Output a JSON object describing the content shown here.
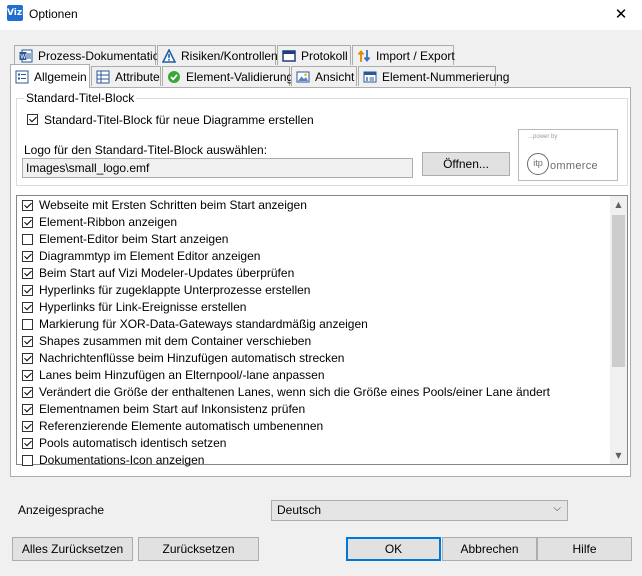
{
  "window": {
    "title": "Optionen",
    "app_icon_label": "Vizi",
    "close_glyph": "✕"
  },
  "tabs_row1": [
    {
      "label": "Prozess-Dokumentation",
      "icon": "word-doc-icon"
    },
    {
      "label": "Risiken/Kontrollen",
      "icon": "warning-triangle-icon"
    },
    {
      "label": "Protokoll",
      "icon": "window-log-icon"
    },
    {
      "label": "Import / Export",
      "icon": "import-export-arrows-icon"
    }
  ],
  "tabs_row2": [
    {
      "label": "Allgemein",
      "icon": "list-icon",
      "active": true
    },
    {
      "label": "Attribute",
      "icon": "table-icon"
    },
    {
      "label": "Element-Validierung",
      "icon": "green-check-icon"
    },
    {
      "label": "Ansicht",
      "icon": "image-view-icon"
    },
    {
      "label": "Element-Nummerierung",
      "icon": "numbering-icon"
    }
  ],
  "title_block": {
    "group_label": "Standard-Titel-Block",
    "checkbox_label": "Standard-Titel-Block für neue Diagramme erstellen",
    "checkbox_checked": true,
    "logo_label": "Logo für den Standard-Titel-Block auswählen:",
    "logo_path": "Images\\small_logo.emf",
    "open_button": "Öffnen...",
    "logo_preview": {
      "small_text": "…power by",
      "circle_text": "itp",
      "word_text": "ommerce"
    }
  },
  "options_list": [
    {
      "label": "Webseite mit Ersten Schritten beim Start anzeigen",
      "checked": true
    },
    {
      "label": "Element-Ribbon anzeigen",
      "checked": true
    },
    {
      "label": "Element-Editor beim Start anzeigen",
      "checked": false
    },
    {
      "label": "Diagrammtyp im Element Editor anzeigen",
      "checked": true
    },
    {
      "label": "Beim Start auf Vizi Modeler-Updates überprüfen",
      "checked": true
    },
    {
      "label": "Hyperlinks für zugeklappte Unterprozesse erstellen",
      "checked": true
    },
    {
      "label": "Hyperlinks für Link-Ereignisse erstellen",
      "checked": true
    },
    {
      "label": "Markierung für XOR-Data-Gateways standardmäßig anzeigen",
      "checked": false
    },
    {
      "label": "Shapes zusammen mit dem Container verschieben",
      "checked": true
    },
    {
      "label": "Nachrichtenflüsse beim Hinzufügen automatisch strecken",
      "checked": true
    },
    {
      "label": "Lanes beim Hinzufügen an Elternpool/-lane anpassen",
      "checked": true
    },
    {
      "label": "Verändert die Größe der enthaltenen Lanes, wenn sich die Größe eines Pools/einer Lane ändert",
      "checked": true
    },
    {
      "label": "Elementnamen beim Start auf Inkonsistenz prüfen",
      "checked": true
    },
    {
      "label": "Referenzierende Elemente automatisch umbenennen",
      "checked": true
    },
    {
      "label": "Pools automatisch identisch setzen",
      "checked": true
    },
    {
      "label": "Dokumentations-Icon anzeigen",
      "checked": false
    }
  ],
  "language": {
    "label": "Anzeigesprache",
    "selected": "Deutsch"
  },
  "buttons": {
    "reset_all": "Alles Zurücksetzen",
    "reset": "Zurücksetzen",
    "ok": "OK",
    "cancel": "Abbrechen",
    "help": "Hilfe"
  },
  "colors": {
    "accent": "#0078d7",
    "window_bg": "#f0f0f0"
  }
}
